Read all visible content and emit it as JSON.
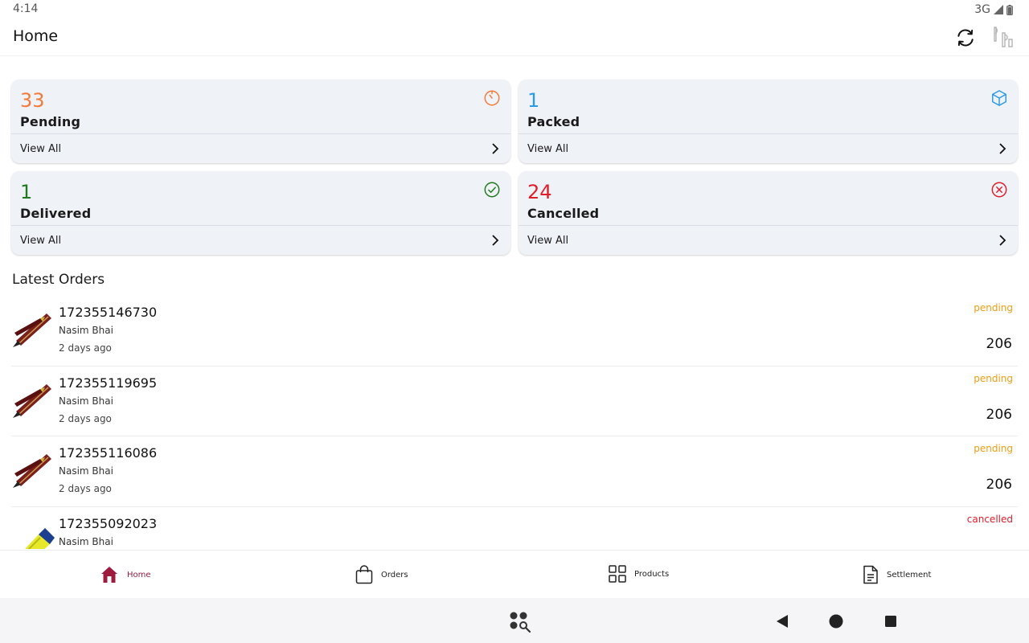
{
  "status_bar": {
    "time": "4:14",
    "network": "3G"
  },
  "app_bar": {
    "title": "Home"
  },
  "summary_cards": [
    {
      "count": "33",
      "label": "Pending",
      "link": "View All",
      "color": "#f47a3a",
      "icon": "timer-icon"
    },
    {
      "count": "1",
      "label": "Packed",
      "link": "View All",
      "color": "#2b9be6",
      "icon": "package-icon"
    },
    {
      "count": "1",
      "label": "Delivered",
      "link": "View All",
      "color": "#1f7a1f",
      "icon": "check-circle-icon"
    },
    {
      "count": "24",
      "label": "Cancelled",
      "link": "View All",
      "color": "#e11d2a",
      "icon": "x-circle-icon"
    }
  ],
  "latest_orders": {
    "title": "Latest Orders",
    "items": [
      {
        "id": "172355146730",
        "customer": "Nasim Bhai",
        "time": "2 days ago",
        "status": "pending",
        "amount": "206",
        "thumb": "pen"
      },
      {
        "id": "172355119695",
        "customer": "Nasim Bhai",
        "time": "2 days ago",
        "status": "pending",
        "amount": "206",
        "thumb": "pen"
      },
      {
        "id": "172355116086",
        "customer": "Nasim Bhai",
        "time": "2 days ago",
        "status": "pending",
        "amount": "206",
        "thumb": "pen"
      },
      {
        "id": "172355092023",
        "customer": "Nasim Bhai",
        "time": "",
        "status": "cancelled",
        "amount": "",
        "thumb": "highlighter"
      }
    ]
  },
  "status_colors": {
    "pending": "#f39c12",
    "cancelled": "#e11d2a"
  },
  "bottom_nav": [
    {
      "label": "Home",
      "icon": "home-icon",
      "active": true
    },
    {
      "label": "Orders",
      "icon": "shopping-bag-icon",
      "active": false
    },
    {
      "label": "Products",
      "icon": "grid-icon",
      "active": false
    },
    {
      "label": "Settlement",
      "icon": "document-icon",
      "active": false
    }
  ],
  "theme": {
    "accent": "#9c1b3f",
    "card_bg": "#eff2f6"
  }
}
